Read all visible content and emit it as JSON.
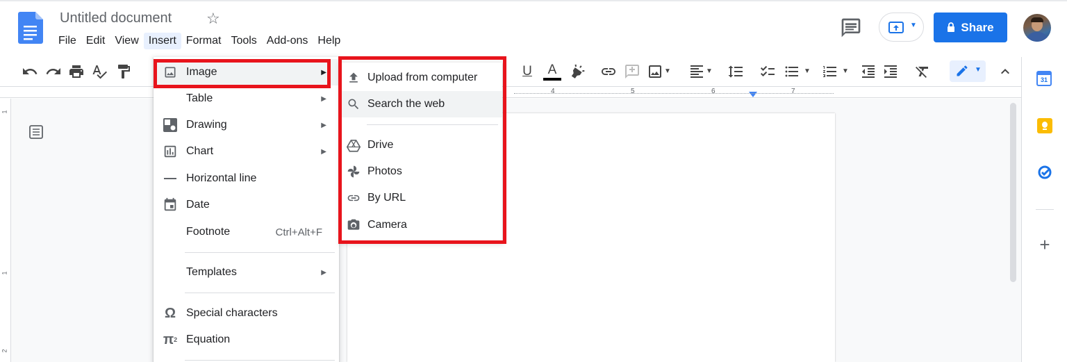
{
  "document": {
    "title": "Untitled document"
  },
  "menubar": {
    "items": [
      {
        "label": "File"
      },
      {
        "label": "Edit"
      },
      {
        "label": "View"
      },
      {
        "label": "Insert"
      },
      {
        "label": "Format"
      },
      {
        "label": "Tools"
      },
      {
        "label": "Add-ons"
      },
      {
        "label": "Help"
      }
    ],
    "active": "Insert"
  },
  "header": {
    "share_label": "Share"
  },
  "toolbar": {
    "icons": [
      "undo-icon",
      "redo-icon",
      "print-icon",
      "spellcheck-icon",
      "paint-format-icon",
      "underline-icon",
      "text-color-icon",
      "highlight-icon",
      "link-icon",
      "comment-add-icon",
      "image-icon",
      "align-icon",
      "line-spacing-icon",
      "checklist-icon",
      "bulleted-list-icon",
      "numbered-list-icon",
      "decrease-indent-icon",
      "increase-indent-icon",
      "clear-formatting-icon",
      "editing-mode-icon",
      "collapse-icon"
    ],
    "text_color_bar": "#000000"
  },
  "ruler": {
    "ticks": [
      "4",
      "5",
      "6",
      "7"
    ]
  },
  "vertical_ruler": {
    "ticks": [
      "1",
      "1",
      "2"
    ]
  },
  "insert_menu": {
    "items": [
      {
        "label": "Image",
        "icon": "image-icon",
        "submenu": true
      },
      {
        "label": "Table",
        "icon": "",
        "submenu": true
      },
      {
        "label": "Drawing",
        "icon": "drawing-icon",
        "submenu": true
      },
      {
        "label": "Chart",
        "icon": "chart-icon",
        "submenu": true
      },
      {
        "label": "Horizontal line",
        "icon": "horizontal-line-icon"
      },
      {
        "label": "Date",
        "icon": "calendar-icon"
      },
      {
        "label": "Footnote",
        "icon": "",
        "shortcut": "Ctrl+Alt+F"
      },
      {
        "label": "Templates",
        "icon": "",
        "submenu": true
      },
      {
        "label": "Special characters",
        "icon": "omega-icon"
      },
      {
        "label": "Equation",
        "icon": "pi-icon"
      }
    ],
    "highlighted": "Image"
  },
  "image_submenu": {
    "items": [
      {
        "label": "Upload from computer",
        "icon": "upload-icon"
      },
      {
        "label": "Search the web",
        "icon": "search-icon"
      },
      {
        "label": "Drive",
        "icon": "drive-icon"
      },
      {
        "label": "Photos",
        "icon": "photos-icon"
      },
      {
        "label": "By URL",
        "icon": "link-icon"
      },
      {
        "label": "Camera",
        "icon": "camera-icon"
      }
    ],
    "highlighted": "Search the web"
  },
  "side_panel": {
    "calendar_day": "31",
    "icons": [
      "calendar-icon",
      "keep-icon",
      "tasks-icon",
      "add-icon"
    ]
  },
  "colors": {
    "accent": "#1a73e8",
    "highlight_box": "#e8141c"
  }
}
